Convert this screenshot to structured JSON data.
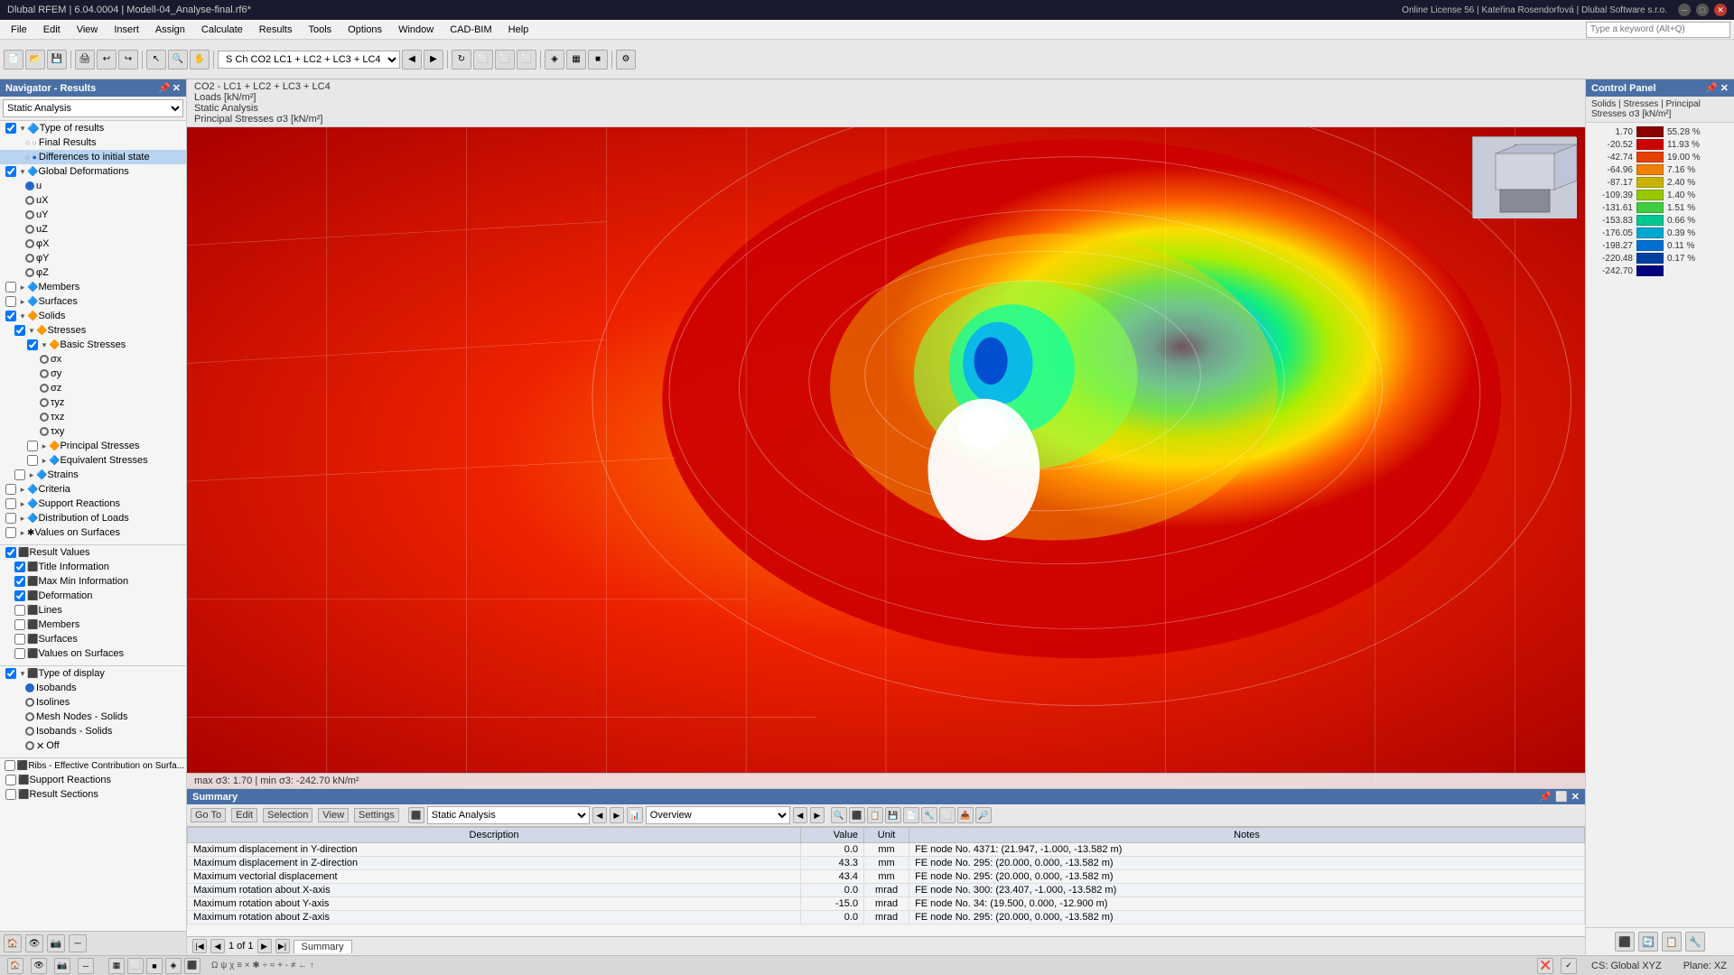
{
  "titlebar": {
    "title": "Dlubal RFEM | 6.04.0004 | Modell-04_Analyse-final.rf6*",
    "license": "Online License 56 | Kateřina Rosendorfová | Dlubal Software s.r.o.",
    "search_placeholder": "Type a keyword (Alt+Q)"
  },
  "menubar": {
    "items": [
      "File",
      "Edit",
      "View",
      "Insert",
      "Assign",
      "Calculate",
      "Results",
      "Tools",
      "Options",
      "Window",
      "CAD-BIM",
      "Help"
    ]
  },
  "navigator": {
    "title": "Navigator - Results",
    "search_label": "Static Analysis",
    "tree": {
      "type_of_results": "Type of results",
      "final_results": "Final Results",
      "differences": "Differences to initial state",
      "global_deformations": "Global Deformations",
      "u": "u",
      "ux": "uX",
      "uy": "uY",
      "uz": "uZ",
      "phix": "φX",
      "phiy": "φY",
      "phiz": "φZ",
      "members": "Members",
      "surfaces": "Surfaces",
      "solids": "Solids",
      "stresses": "Stresses",
      "basic_stresses": "Basic Stresses",
      "sigmax": "σx",
      "sigmay": "σy",
      "sigmaz": "σz",
      "tauyz": "τyz",
      "tauxz": "τxz",
      "tauxy": "τxy",
      "principal_stresses": "Principal Stresses",
      "equivalent_stresses": "Equivalent Stresses",
      "strains": "Strains",
      "criteria": "Criteria",
      "support_reactions": "Support Reactions",
      "dist_loads": "Distribution of Loads",
      "values_on_surfaces": "Values on Surfaces",
      "result_values": "Result Values",
      "title_information": "Title Information",
      "max_min_info": "Max Min Information",
      "deformation": "Deformation",
      "lines": "Lines",
      "members2": "Members",
      "surfaces2": "Surfaces",
      "values_on_surfaces2": "Values on Surfaces",
      "type_of_display": "Type of display",
      "isobands": "Isobands",
      "isolines": "Isolines",
      "mesh_nodes_solids": "Mesh Nodes - Solids",
      "isobands_solids": "Isobands - Solids",
      "off": "Off",
      "ribs": "Ribs - Effective Contribution on Surfa...",
      "support_reactions2": "Support Reactions",
      "result_sections": "Result Sections"
    }
  },
  "info_bar": {
    "combination": "CO2 - LC1 + LC2 + LC3 + LC4",
    "loads_unit": "Loads [kN/m²]",
    "analysis_type": "Static Analysis",
    "stress_label": "Principal Stresses σ3 [kN/m²]"
  },
  "viewport": {
    "max_stress": "max σ3: 1.70 | min σ3: -242.70 kN/m²"
  },
  "legend": {
    "title": "Control Panel",
    "subtitle": "Solids | Stresses | Principal Stresses σ3 [kN/m²]",
    "entries": [
      {
        "value": "1.70",
        "color": "#8B0000",
        "pct": "55.28 %"
      },
      {
        "value": "-20.52",
        "color": "#cc0000",
        "pct": "11.93 %"
      },
      {
        "value": "-42.74",
        "color": "#e84000",
        "pct": "19.00 %"
      },
      {
        "value": "-64.96",
        "color": "#f08000",
        "pct": "7.16 %"
      },
      {
        "value": "-87.17",
        "color": "#c8b400",
        "pct": "2.40 %"
      },
      {
        "value": "-109.39",
        "color": "#98c800",
        "pct": "1.40 %"
      },
      {
        "value": "-131.61",
        "color": "#40cc40",
        "pct": "1.51 %"
      },
      {
        "value": "-153.83",
        "color": "#00c890",
        "pct": "0.66 %"
      },
      {
        "value": "-176.05",
        "color": "#00a8d0",
        "pct": "0.39 %"
      },
      {
        "value": "-198.27",
        "color": "#0070d0",
        "pct": "0.11 %"
      },
      {
        "value": "-220.48",
        "color": "#0040a0",
        "pct": "0.17 %"
      },
      {
        "value": "-242.70",
        "color": "#000080",
        "pct": ""
      }
    ]
  },
  "summary": {
    "title": "Summary",
    "menus": [
      "Go To",
      "Edit",
      "Selection",
      "View",
      "Settings"
    ],
    "analysis_label": "Static Analysis",
    "overview_label": "Overview",
    "combination_label": "S Ch  CO2  LC1 + LC2 + LC3 + LC4",
    "page": "1 of 1",
    "tab_label": "Summary",
    "columns": [
      "Description",
      "Value",
      "Unit",
      "Notes"
    ],
    "rows": [
      {
        "desc": "Maximum displacement in Y-direction",
        "val": "0.0",
        "unit": "mm",
        "notes": "FE node No. 4371: (21.947, -1.000, -13.582 m)"
      },
      {
        "desc": "Maximum displacement in Z-direction",
        "val": "43.3",
        "unit": "mm",
        "notes": "FE node No. 295: (20.000, 0.000, -13.582 m)"
      },
      {
        "desc": "Maximum vectorial displacement",
        "val": "43.4",
        "unit": "mm",
        "notes": "FE node No. 295: (20.000, 0.000, -13.582 m)"
      },
      {
        "desc": "Maximum rotation about X-axis",
        "val": "0.0",
        "unit": "mrad",
        "notes": "FE node No. 300: (23.407, -1.000, -13.582 m)"
      },
      {
        "desc": "Maximum rotation about Y-axis",
        "val": "-15.0",
        "unit": "mrad",
        "notes": "FE node No. 34: (19.500, 0.000, -12.900 m)"
      },
      {
        "desc": "Maximum rotation about Z-axis",
        "val": "0.0",
        "unit": "mrad",
        "notes": "FE node No. 295: (20.000, 0.000, -13.582 m)"
      }
    ]
  },
  "statusbar": {
    "icons_left": [
      "home",
      "eye",
      "camera",
      "line"
    ],
    "cs": "CS: Global XYZ",
    "plane": "Plane: XZ"
  }
}
